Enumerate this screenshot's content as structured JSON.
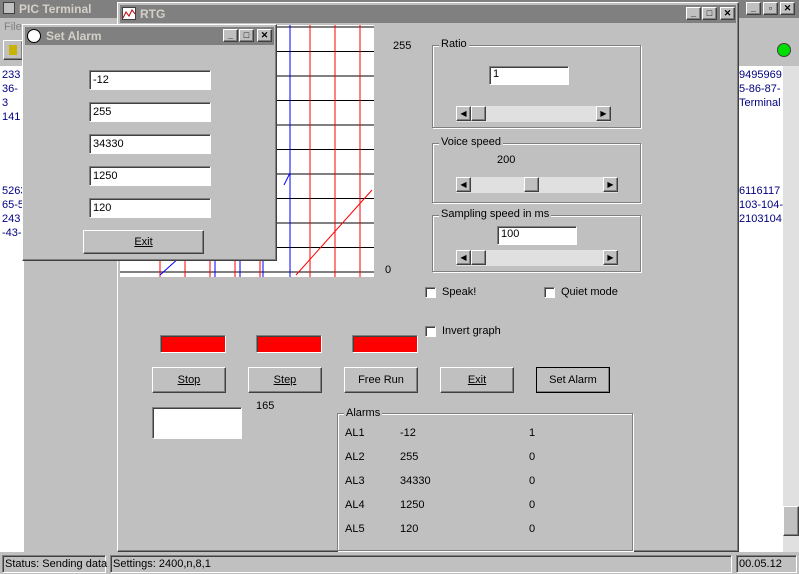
{
  "pic_terminal": {
    "title": "PIC Terminal",
    "menu_file": "File",
    "left_lines": [
      "233",
      "36-3",
      "141",
      "5263",
      "65-5",
      "243",
      "-43-"
    ],
    "right_lines": [
      "9495969",
      "5-86-87-",
      "Terminal",
      "6116117",
      "103-104-",
      "2103104"
    ],
    "status": "Status: Sending data",
    "settings": "Settings: 2400,n,8,1",
    "time": "00.05.12"
  },
  "rtg": {
    "title": "RTG",
    "graph_max": "255",
    "graph_min": "0",
    "ratio": {
      "label": "Ratio",
      "value": "1",
      "slider_level": 0.0
    },
    "voice": {
      "label": "Voice speed",
      "value": "200",
      "slider_level": 0.45
    },
    "sampling": {
      "label": "Sampling speed in ms",
      "value": "100",
      "slider_level": 0.0
    },
    "speak_label": "Speak!",
    "quiet_label": "Quiet mode",
    "invert_label": "Invert graph",
    "buttons": {
      "stop": "Stop",
      "step": "Step",
      "free_run": "Free Run",
      "exit": "Exit",
      "set_alarm": "Set Alarm"
    },
    "counter": "165",
    "alarms": {
      "label": "Alarms",
      "rows": [
        {
          "name": "AL1",
          "value": "-12",
          "state": "1"
        },
        {
          "name": "AL2",
          "value": "255",
          "state": "0"
        },
        {
          "name": "AL3",
          "value": "34330",
          "state": "0"
        },
        {
          "name": "AL4",
          "value": "1250",
          "state": "0"
        },
        {
          "name": "AL5",
          "value": "120",
          "state": "0"
        }
      ]
    },
    "colors": {
      "indicator": "#ff0000",
      "grid_red": "#ff0000",
      "trace_blue": "#0000ff"
    }
  },
  "set_alarm": {
    "title": "Set Alarm",
    "fields": [
      "-12",
      "255",
      "34330",
      "1250",
      "120"
    ],
    "exit": "Exit"
  }
}
